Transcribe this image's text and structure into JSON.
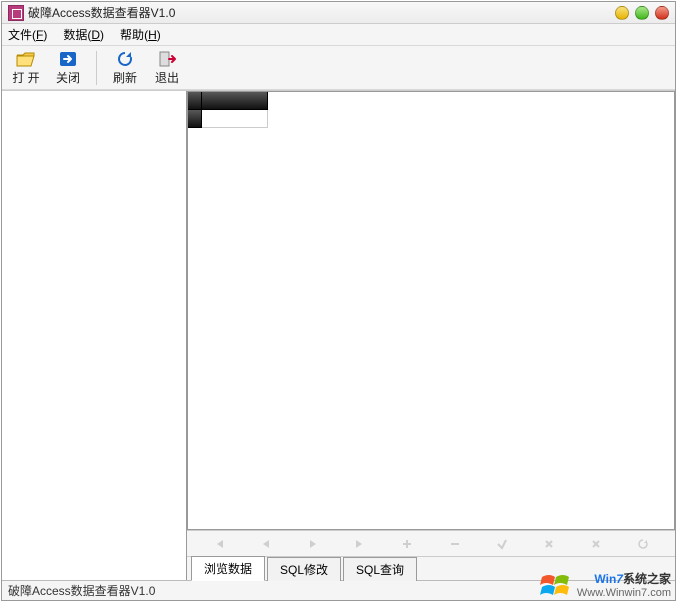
{
  "window": {
    "title": "破障Access数据查看器V1.0"
  },
  "menu": {
    "file": {
      "label": "文件",
      "hotkey": "F"
    },
    "data": {
      "label": "数据",
      "hotkey": "D"
    },
    "help": {
      "label": "帮助",
      "hotkey": "H"
    }
  },
  "toolbar": {
    "open": {
      "label": "打 开"
    },
    "close": {
      "label": "关闭"
    },
    "refresh": {
      "label": "刷新"
    },
    "exit": {
      "label": "退出"
    }
  },
  "tabs": {
    "browse": {
      "label": "浏览数据"
    },
    "modify": {
      "label": "SQL修改"
    },
    "query": {
      "label": "SQL查询"
    }
  },
  "status": {
    "text": "破障Access数据查看器V1.0"
  },
  "watermark": {
    "line1_win": "Win",
    "line1_seven": "7",
    "line1_cn": "系统之家",
    "line2": "Www.Winwin7.com"
  }
}
